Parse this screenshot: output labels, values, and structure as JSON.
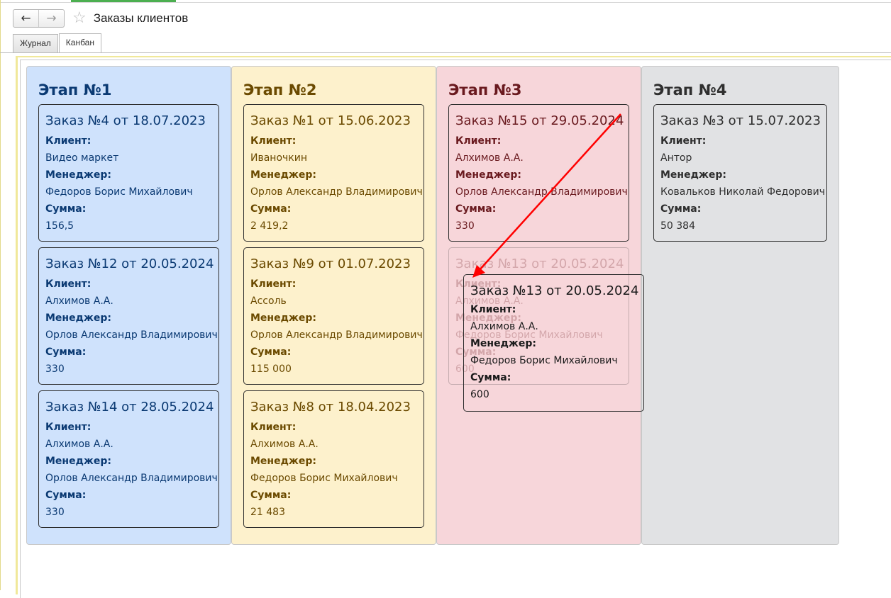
{
  "window": {
    "title": "Заказы клиентов",
    "back_icon": "←",
    "forward_icon": "→",
    "favorite_icon": "☆"
  },
  "tabs": [
    {
      "label": "Журнал",
      "active": false
    },
    {
      "label": "Канбан",
      "active": true
    }
  ],
  "labels": {
    "client": "Клиент:",
    "manager": "Менеджер:",
    "sum": "Сумма:"
  },
  "colors": {
    "stage1_bg": "#cfe2fc",
    "stage1_text": "#0b3a73",
    "stage2_bg": "#fdf1cc",
    "stage2_text": "#6b4a00",
    "stage3_bg": "#f7d6da",
    "stage3_text": "#6a1a1f",
    "stage4_bg": "#e1e2e4",
    "stage4_text": "#2f2f2f",
    "arrow": "#ff0000"
  },
  "columns": [
    {
      "title": "Этап №1",
      "cards": [
        {
          "title": "Заказ №4 от 18.07.2023",
          "client": "Видео маркет",
          "manager": "Федоров Борис Михайлович",
          "sum": "156,5"
        },
        {
          "title": "Заказ №12 от 20.05.2024",
          "client": "Алхимов А.А.",
          "manager": "Орлов Александр Владимирович",
          "sum": "330"
        },
        {
          "title": "Заказ №14 от 28.05.2024",
          "client": "Алхимов А.А.",
          "manager": "Орлов Александр Владимирович",
          "sum": "330"
        }
      ]
    },
    {
      "title": "Этап №2",
      "cards": [
        {
          "title": "Заказ №1 от 15.06.2023",
          "client": "Иваночкин",
          "manager": "Орлов Александр Владимирович",
          "sum": "2 419,2"
        },
        {
          "title": "Заказ №9 от 01.07.2023",
          "client": "Ассоль",
          "manager": "Орлов Александр Владимирович",
          "sum": "115 000"
        },
        {
          "title": "Заказ №8 от 18.04.2023",
          "client": "Алхимов А.А.",
          "manager": "Федоров Борис Михайлович",
          "sum": "21 483"
        }
      ]
    },
    {
      "title": "Этап №3",
      "cards": [
        {
          "title": "Заказ №15 от 29.05.2024",
          "client": "Алхимов А.А.",
          "manager": "Орлов Александр Владимирович",
          "sum": "330"
        },
        {
          "title": "Заказ №13 от 20.05.2024",
          "client": "Алхимов А.А.",
          "manager": "Федоров Борис Михайлович",
          "sum": "600",
          "ghost": true
        }
      ]
    },
    {
      "title": "Этап №4",
      "cards": [
        {
          "title": "Заказ №3 от 15.07.2023",
          "client": "Антор",
          "manager": "Ковальков Николай Федорович",
          "sum": "50 384"
        }
      ]
    }
  ],
  "dragging_card": {
    "title": "Заказ №13 от 20.05.2024",
    "client": "Алхимов А.А.",
    "manager": "Федоров Борис Михайлович",
    "sum": "600"
  }
}
